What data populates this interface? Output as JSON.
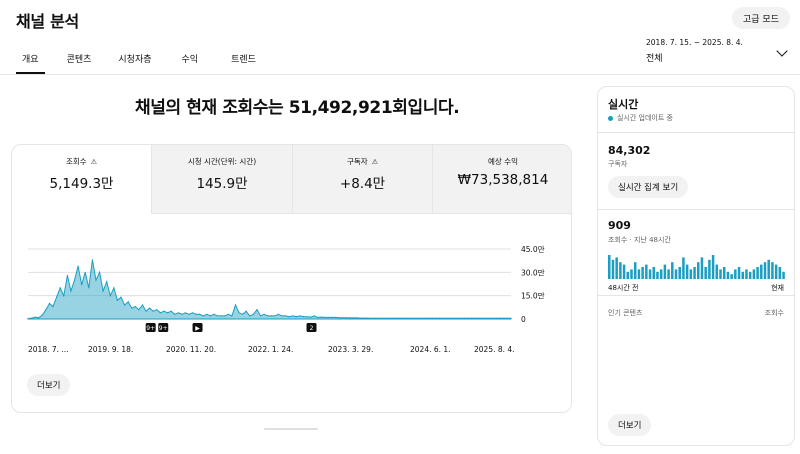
{
  "header": {
    "title": "채널 분석",
    "advanced_mode": "고급 모드"
  },
  "tabs": [
    {
      "label": "개요",
      "active": true
    },
    {
      "label": "콘텐츠",
      "active": false
    },
    {
      "label": "시청자층",
      "active": false
    },
    {
      "label": "수익",
      "active": false
    },
    {
      "label": "트렌드",
      "active": false
    }
  ],
  "date_picker": {
    "range": "2018. 7. 15. ~ 2025. 8. 4.",
    "label": "전체",
    "icon": "chevron-down-icon"
  },
  "headline": "채널의 현재 조회수는 51,492,921회입니다.",
  "metrics": [
    {
      "label": "조회수",
      "value": "5,149.3만",
      "warning": true,
      "active": true
    },
    {
      "label": "시청 시간(단위: 시간)",
      "value": "145.9만",
      "warning": false,
      "active": false
    },
    {
      "label": "구독자",
      "value": "+8.4만",
      "warning": true,
      "active": false
    },
    {
      "label": "예상 수익",
      "value": "₩73,538,814",
      "warning": false,
      "active": false
    }
  ],
  "chart_data": {
    "type": "area",
    "series": [
      {
        "values": [
          0.3,
          0.5,
          1.2,
          0.8,
          2.5,
          6,
          10,
          8,
          14,
          20,
          15,
          28,
          18,
          25,
          34,
          22,
          30,
          20,
          38,
          25,
          30,
          18,
          24,
          15,
          20,
          12,
          14,
          9,
          11,
          7,
          8,
          6,
          9,
          5,
          7,
          5,
          6,
          4,
          5,
          4,
          5,
          3,
          4,
          3,
          4,
          3,
          4,
          3,
          3,
          2,
          3,
          2,
          3,
          2,
          2,
          2,
          3,
          2,
          9,
          4,
          3,
          5,
          2,
          3,
          6,
          2,
          3,
          2,
          2,
          2,
          3,
          2,
          2,
          1.5,
          2,
          1.5,
          2,
          1.5,
          1.5,
          1.2,
          2,
          1,
          1.2,
          1,
          1,
          1,
          1,
          0.8,
          0.8,
          0.8,
          0.7,
          0.7,
          0.7,
          0.6,
          0.6,
          0.6,
          0.5,
          0.5,
          0.5,
          0.5,
          0.5,
          0.5,
          0.5,
          0.5,
          0.5,
          0.5,
          0.5,
          0.5,
          0.5,
          0.5,
          0.5,
          0.5,
          0.5,
          0.5,
          0.5,
          0.5,
          0.5,
          0.5,
          0.5,
          0.5,
          0.5,
          0.5,
          0.5,
          0.5,
          0.5,
          0.5,
          0.5,
          0.5,
          0.5,
          0.5,
          0.5,
          0.5,
          0.5,
          0.5,
          0.5,
          0.5
        ]
      }
    ],
    "x_tick_labels": [
      "2018. 7. ...",
      "2019. 9. 18.",
      "2020. 11. 20.",
      "2022. 1. 24.",
      "2023. 3. 29.",
      "2024. 6. 1.",
      "2025. 8. 4."
    ],
    "y_tick_labels": [
      "45.0만",
      "30.0만",
      "15.0만",
      "0"
    ],
    "ylim": [
      0,
      45
    ],
    "grid": true,
    "color": "#1a9ec2",
    "markers": [
      {
        "label": "9+",
        "pos": 0.254
      },
      {
        "label": "9+",
        "pos": 0.28
      },
      {
        "label": "▶",
        "pos": 0.351
      },
      {
        "label": "2",
        "pos": 0.587
      }
    ]
  },
  "more_button": "더보기",
  "realtime": {
    "title": "실시간",
    "update_text": "실시간 업데이트 중",
    "subscribers": "84,302",
    "subscribers_label": "구독자",
    "count_button": "실시간 집계 보기",
    "views": "909",
    "views_label": "조회수 · 지난 48시간",
    "mini_chart": [
      10,
      8,
      9,
      7,
      6,
      3,
      4,
      7,
      4,
      5,
      6,
      4,
      5,
      3,
      4,
      6,
      4,
      7,
      4,
      5,
      9,
      6,
      4,
      5,
      7,
      9,
      5,
      8,
      10,
      6,
      4,
      5,
      3,
      2,
      4,
      5,
      3,
      4,
      3,
      4,
      5,
      6,
      7,
      8,
      7,
      6,
      5,
      3
    ],
    "axis_left": "48시간 전",
    "axis_right": "현재",
    "popular_label": "인기 콘텐츠",
    "popular_metric": "조회수",
    "more_button": "더보기"
  }
}
